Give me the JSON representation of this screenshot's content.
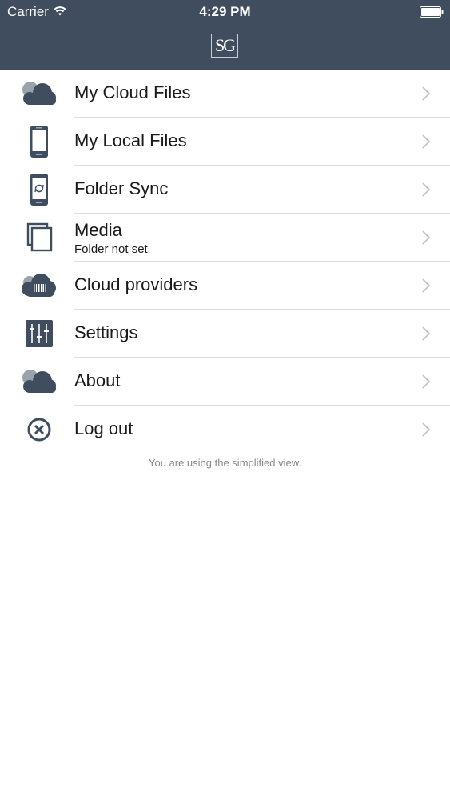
{
  "status_bar": {
    "carrier": "Carrier",
    "time": "4:29 PM"
  },
  "header": {
    "logo_text": "SG"
  },
  "menu": [
    {
      "label": "My Cloud Files",
      "icon": "cloud-icon"
    },
    {
      "label": "My Local Files",
      "icon": "phone-icon"
    },
    {
      "label": "Folder Sync",
      "icon": "phone-sync-icon"
    },
    {
      "label": "Media",
      "sublabel": "Folder not set",
      "icon": "media-icon"
    },
    {
      "label": "Cloud providers",
      "icon": "cloud-provider-icon"
    },
    {
      "label": "Settings",
      "icon": "sliders-icon"
    },
    {
      "label": "About",
      "icon": "cloud-icon"
    },
    {
      "label": "Log out",
      "icon": "close-circle-icon"
    }
  ],
  "footer_text": "You are using the simplified view.",
  "colors": {
    "header_bg": "#3f4d5e",
    "icon": "#3f4d5e",
    "chevron": "#c7c7cc"
  }
}
